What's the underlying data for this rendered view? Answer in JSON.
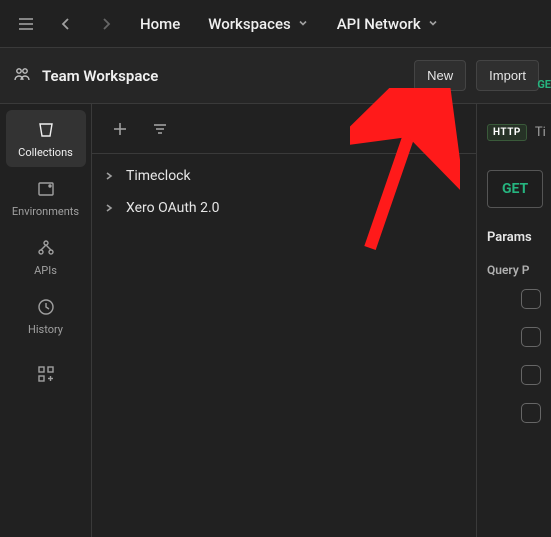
{
  "topnav": {
    "home": "Home",
    "workspaces": "Workspaces",
    "api_network": "API Network"
  },
  "workspace": {
    "title": "Team Workspace",
    "new_btn": "New",
    "import_btn": "Import"
  },
  "sidebar": {
    "items": [
      {
        "label": "Collections"
      },
      {
        "label": "Environments"
      },
      {
        "label": "APIs"
      },
      {
        "label": "History"
      }
    ]
  },
  "collections": [
    {
      "name": "Timeclock"
    },
    {
      "name": "Xero OAuth 2.0"
    }
  ],
  "request": {
    "method_badge": "HTTP",
    "tab_title_partial": "Ti",
    "method": "GET",
    "params_label": "Params",
    "query_params_label": "Query P",
    "green_partial": "GE"
  }
}
